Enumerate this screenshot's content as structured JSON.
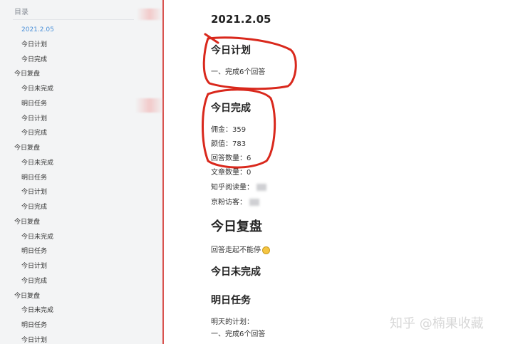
{
  "sidebar": {
    "header": "目录",
    "items": [
      {
        "label": "2021.2.05",
        "level": 2,
        "active": true
      },
      {
        "label": "今日计划",
        "level": 2
      },
      {
        "label": "今日完成",
        "level": 2
      },
      {
        "label": "今日复盘",
        "level": 1
      },
      {
        "label": "今日未完成",
        "level": 2
      },
      {
        "label": "明日任务",
        "level": 2
      },
      {
        "label": "今日计划",
        "level": 2
      },
      {
        "label": "今日完成",
        "level": 2
      },
      {
        "label": "今日复盘",
        "level": 1
      },
      {
        "label": "今日未完成",
        "level": 2
      },
      {
        "label": "明日任务",
        "level": 2
      },
      {
        "label": "今日计划",
        "level": 2
      },
      {
        "label": "今日完成",
        "level": 2
      },
      {
        "label": "今日复盘",
        "level": 1
      },
      {
        "label": "今日未完成",
        "level": 2
      },
      {
        "label": "明日任务",
        "level": 2
      },
      {
        "label": "今日计划",
        "level": 2
      },
      {
        "label": "今日完成",
        "level": 2
      },
      {
        "label": "今日复盘",
        "level": 1
      },
      {
        "label": "今日未完成",
        "level": 2
      },
      {
        "label": "明日任务",
        "level": 2
      },
      {
        "label": "今日计划",
        "level": 2
      }
    ]
  },
  "doc": {
    "date_title": "2021.2.05",
    "plan_heading": "今日计划",
    "plan_item": "一、完成6个回答",
    "done_heading": "今日完成",
    "commission": "佣金：359",
    "views": "颜值：783",
    "answers": "回答数量：6",
    "articles": "文章数量：0",
    "zhihu_reads": "知乎阅读量：",
    "jd_visitors": "京粉访客：",
    "review_heading": "今日复盘",
    "review_text": "回答走起不能停",
    "undone_heading": "今日未完成",
    "tomorrow_heading": "明日任务",
    "tomorrow_plan": "明天的计划：",
    "tomorrow_item": "一、完成6个回答"
  },
  "watermark": "知乎 @楠果收藏",
  "colors": {
    "accent": "#4a90d9",
    "annotation": "#d9281c",
    "sidebar_bg": "#f3f4f5"
  }
}
